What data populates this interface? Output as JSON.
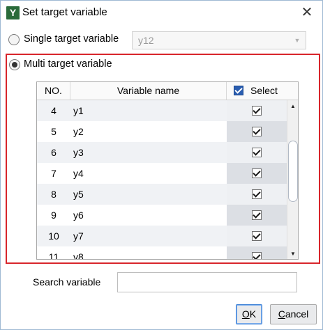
{
  "window": {
    "title": "Set target variable",
    "app_icon": "Y"
  },
  "single": {
    "label": "Single target variable",
    "selected": false,
    "select_value": "y12"
  },
  "multi": {
    "label": "Multi target variable",
    "selected": true
  },
  "table": {
    "headers": {
      "no": "NO.",
      "name": "Variable name",
      "select": "Select"
    },
    "header_select_checked": true,
    "rows": [
      {
        "no": "4",
        "name": "y1",
        "checked": true
      },
      {
        "no": "5",
        "name": "y2",
        "checked": true
      },
      {
        "no": "6",
        "name": "y3",
        "checked": true
      },
      {
        "no": "7",
        "name": "y4",
        "checked": true
      },
      {
        "no": "8",
        "name": "y5",
        "checked": true
      },
      {
        "no": "9",
        "name": "y6",
        "checked": true
      },
      {
        "no": "10",
        "name": "y7",
        "checked": true
      },
      {
        "no": "11",
        "name": "y8",
        "checked": true
      }
    ]
  },
  "search": {
    "label": "Search variable",
    "value": ""
  },
  "buttons": {
    "ok": {
      "mnemonic": "O",
      "rest": "K"
    },
    "cancel": {
      "mnemonic": "C",
      "rest": "ancel"
    }
  },
  "colors": {
    "highlight_border": "#d8252b",
    "app_icon_bg": "#2a6b3a"
  }
}
